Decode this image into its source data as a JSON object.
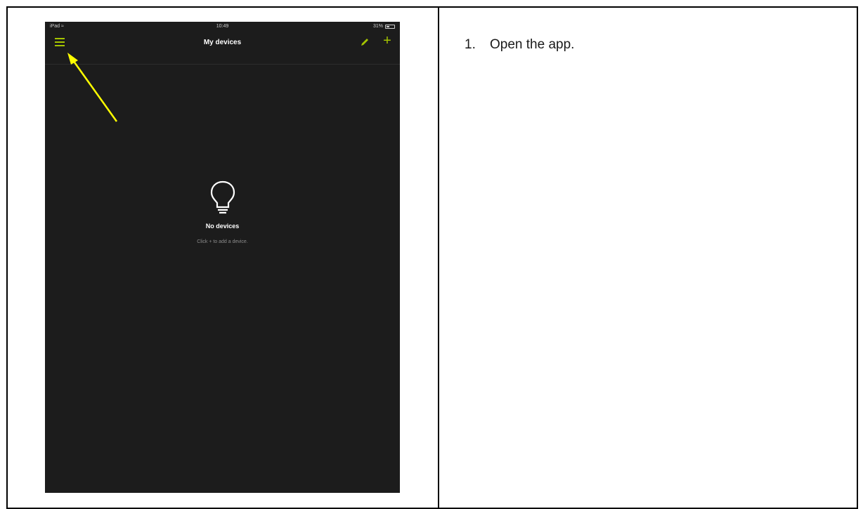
{
  "phone": {
    "status": {
      "carrier": "iPad",
      "time": "10:49",
      "battery": "31%"
    },
    "nav": {
      "title": "My devices",
      "add_label": "+"
    },
    "empty": {
      "title": "No devices",
      "hint": "Click + to add a device."
    }
  },
  "instructions": {
    "steps": [
      {
        "number": "1.",
        "text": "Open the app."
      }
    ]
  },
  "colors": {
    "accent": "#a4c400",
    "arrow": "#ffff00",
    "screen_bg": "#1c1c1c"
  },
  "icons": {
    "menu": "hamburger-icon",
    "edit": "pencil-icon",
    "add": "plus-icon",
    "empty": "lightbulb-icon",
    "battery": "battery-icon",
    "wifi": "wifi-icon"
  }
}
